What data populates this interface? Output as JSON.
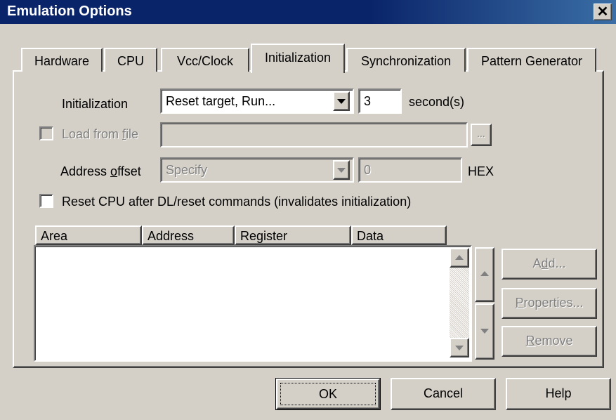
{
  "window": {
    "title": "Emulation Options",
    "close_glyph": "✕"
  },
  "tabs": [
    {
      "label": "Hardware",
      "active": false
    },
    {
      "label": "CPU",
      "active": false
    },
    {
      "label": "Vcc/Clock",
      "active": false
    },
    {
      "label": "Initialization",
      "active": true
    },
    {
      "label": "Synchronization",
      "active": false
    },
    {
      "label": "Pattern Generator",
      "active": false
    }
  ],
  "init": {
    "label": "Initialization",
    "mode_value": "Reset target, Run...",
    "seconds_value": "3",
    "seconds_unit": "second(s)"
  },
  "load": {
    "checkbox_label_pre": "Load from ",
    "checkbox_label_u": "f",
    "checkbox_label_post": "ile",
    "checked": false,
    "file_value": "",
    "browse_label": "..."
  },
  "offset": {
    "label_pre": "Address ",
    "label_u": "o",
    "label_post": "ffset",
    "mode_value": "Specify",
    "value": "0",
    "unit": "HEX"
  },
  "reset_cpu": {
    "label": "Reset CPU after DL/reset commands (invalidates initialization)",
    "checked": false
  },
  "table": {
    "columns": [
      "Area",
      "Address",
      "Register",
      "Data"
    ],
    "rows": []
  },
  "side_buttons": {
    "add_pre": "A",
    "add_u": "d",
    "add_post": "d...",
    "properties_pre": "",
    "properties_u": "P",
    "properties_post": "roperties...",
    "remove_pre": "",
    "remove_u": "R",
    "remove_post": "emove"
  },
  "footer": {
    "ok": "OK",
    "cancel": "Cancel",
    "help": "Help"
  }
}
